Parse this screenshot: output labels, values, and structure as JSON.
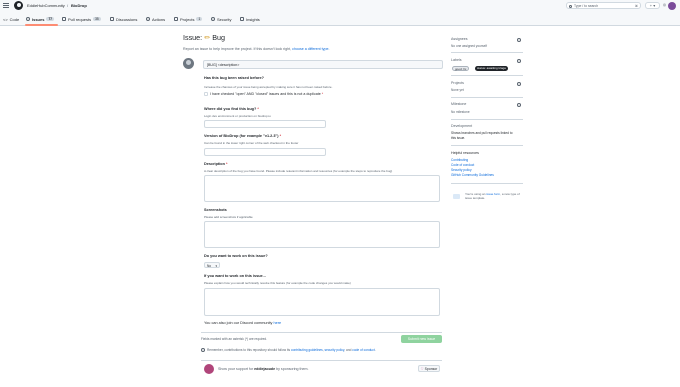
{
  "header": {
    "owner": "EddieHubCommunity",
    "separator": "/",
    "repo": "BioDrop",
    "search_placeholder": "Type / to search",
    "plus_label": "+ ▾"
  },
  "nav": {
    "tabs": [
      {
        "label": "Code"
      },
      {
        "label": "Issues",
        "count": "77"
      },
      {
        "label": "Pull requests",
        "count": "35"
      },
      {
        "label": "Discussions"
      },
      {
        "label": "Actions"
      },
      {
        "label": "Projects",
        "count": "1"
      },
      {
        "label": "Security"
      },
      {
        "label": "Insights"
      }
    ]
  },
  "issue": {
    "title_prefix": "Issue: ",
    "title_emoji": "✏",
    "title_text": " Bug",
    "subtitle_prefix": "Report an issue to help improve the project. If this doesn't look right, ",
    "subtitle_link": "choose a different type.",
    "title_value": "[BUG] <description>"
  },
  "form": {
    "q1_label": "Has this bug been raised before?",
    "q1_help": "Increase the chances of your issue being accepted by making sure it has not been raised before.",
    "q1_checkbox": "I have checked \"open\" AND \"closed\" issues and this is not a duplicate",
    "q1_req": "*",
    "q2_label": "Where did you find this bug?",
    "q2_req": "*",
    "q2_help": "Login dev environment or production on biodrop.io",
    "q3_label": "Version of BioDrop (for example \"v1.2.3\")",
    "q3_req": "*",
    "q3_help": "Can be found in the lower right corner of the web checkout in the footer",
    "q4_label": "Description",
    "q4_req": "*",
    "q4_help": "A clear description of the bug you have found. Please include relevant information and resources (for example the steps to reproduce the bug)",
    "q5_label": "Screenshots",
    "q5_help": "Please add screenshots if applicable",
    "q6_label": "Do you want to work on this issue?",
    "q6_value": "No",
    "q7_label": "If you want to work on this issue...",
    "q7_help": "Please explain how you would technically resolve this feature (for example the code changes you would make)",
    "discord_text": "You can also join our Discord community ",
    "discord_link": "here",
    "required_note": "Fields marked with an asterisk (*) are required.",
    "submit_label": "Submit new issue",
    "remember_prefix": "Remember, contributions to this repository should follow its ",
    "remember_link1": "contributing guidelines",
    "remember_sep1": ", ",
    "remember_link2": "security policy",
    "remember_sep2": ", and ",
    "remember_link3": "code of conduct",
    "remember_end": ".",
    "sponsor_prefix": "Show your support for ",
    "sponsor_name": "eddiejaoude",
    "sponsor_suffix": " by sponsoring them.",
    "sponsor_button": "Sponsor"
  },
  "sidebar": {
    "assignees_h": "Assignees",
    "assignees_v": "No one assigned yourself",
    "labels_h": "Labels",
    "label1": "good: fix",
    "label2": "status: awaiting triage",
    "projects_h": "Projects",
    "projects_v": "None yet",
    "milestone_h": "Milestone",
    "milestone_v": "No milestone",
    "development_h": "Development",
    "development_v1": "Shows branches and pull requests linked to",
    "development_v2": "this issue.",
    "resources_h": "Helpful resources",
    "resources": [
      "Contributing",
      "Code of conduct",
      "Security policy",
      "GitHub Community Guidelines"
    ],
    "issueform_prefix": "You're using an ",
    "issueform_link": "issue form",
    "issueform_suffix": ", a new type of issue template."
  },
  "colors": {
    "accent": "#0969da",
    "submit_disabled": "#8fd39f",
    "label_good": "#e8ebef",
    "label_triage": "#1f2328",
    "active_tab": "#fd8c73"
  }
}
